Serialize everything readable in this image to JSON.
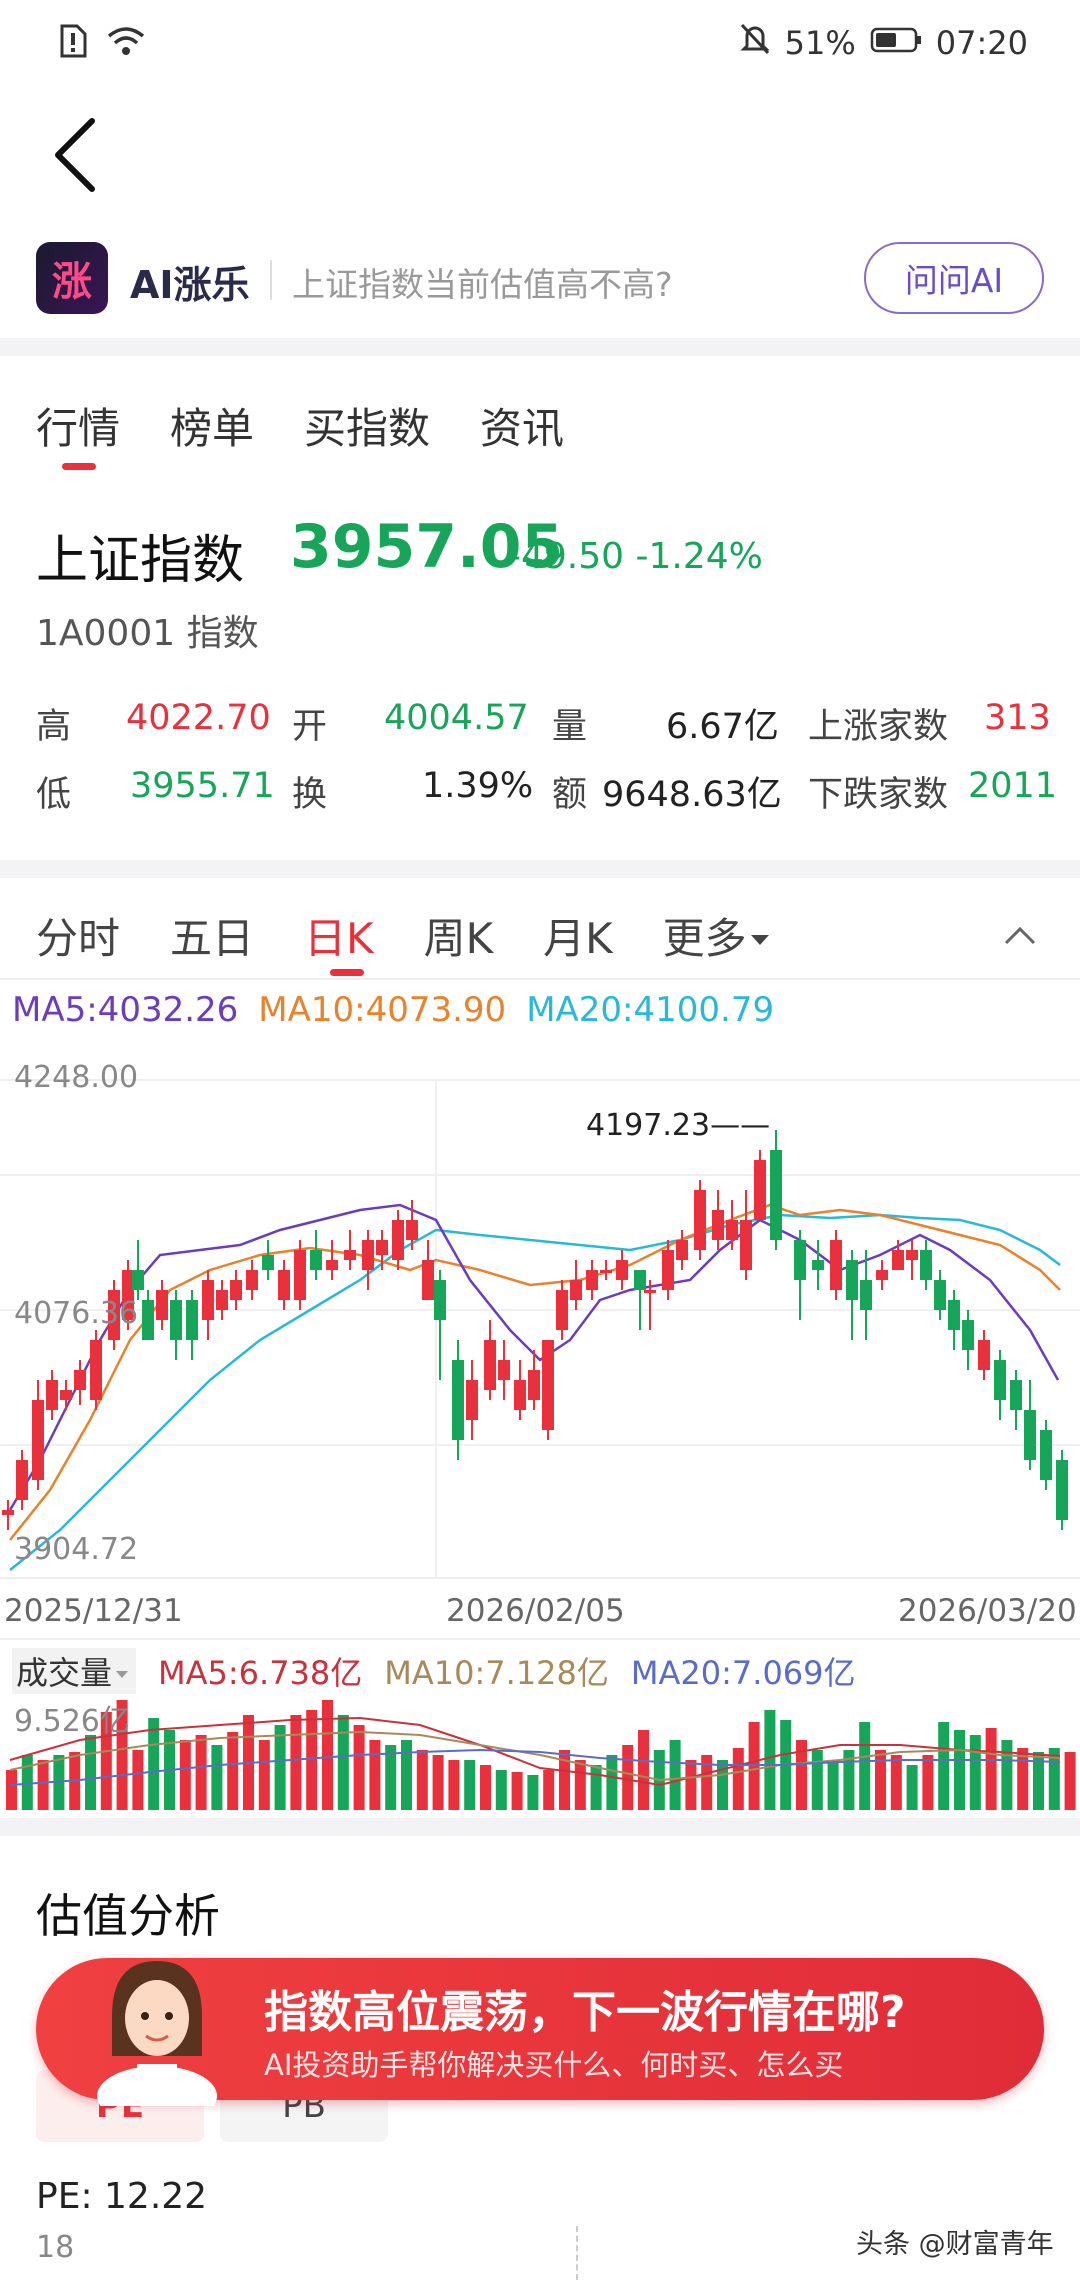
{
  "status_bar": {
    "battery": "51%",
    "time": "07:20"
  },
  "ai_bar": {
    "logo_text": "涨",
    "name": "AI涨乐",
    "question": "上证指数当前估值高不高?",
    "button": "问问AI"
  },
  "tabs": [
    "行情",
    "榜单",
    "买指数",
    "资讯"
  ],
  "index": {
    "name": "上证指数",
    "price": "3957.05",
    "change": "-49.50 -1.24%",
    "code": "1A0001 指数"
  },
  "stats": {
    "high_label": "高",
    "high": "4022.70",
    "open_label": "开",
    "open": "4004.57",
    "volume_label": "量",
    "volume": "6.67亿",
    "up_label": "上涨家数",
    "up": "313",
    "low_label": "低",
    "low": "3955.71",
    "turnover_label": "换",
    "turnover": "1.39%",
    "amount_label": "额",
    "amount": "9648.63亿",
    "down_label": "下跌家数",
    "down": "2011"
  },
  "kline_tabs": [
    "分时",
    "五日",
    "日K",
    "周K",
    "月K",
    "更多"
  ],
  "ma": {
    "ma5": "MA5:4032.26",
    "ma10": "MA10:4073.90",
    "ma20": "MA20:4100.79"
  },
  "axis": {
    "top": "4248.00",
    "mid": "4076.36",
    "bottom": "3904.72",
    "peak": "4197.23"
  },
  "dates": [
    "2025/12/31",
    "2026/02/05",
    "2026/03/20"
  ],
  "volume": {
    "label": "成交量",
    "ma5": "MA5:6.738亿",
    "ma10": "MA10:7.128亿",
    "ma20": "MA20:7.069亿",
    "max": "9.526亿"
  },
  "valuation": {
    "title": "估值分析",
    "pe_tab": "PE",
    "pb_tab": "PB",
    "pe_value": "PE: 12.22",
    "axis_top": "18"
  },
  "banner": {
    "title": "指数高位震荡，下一波行情在哪?",
    "subtitle": "AI投资助手帮你解决买什么、何时买、怎么买"
  },
  "watermark": "头条 @财富青年",
  "colors": {
    "up": "#e8313c",
    "down": "#17a55a",
    "ma5": "#6a3cc0",
    "ma10": "#e8822c",
    "ma20": "#2ab8d8"
  }
}
